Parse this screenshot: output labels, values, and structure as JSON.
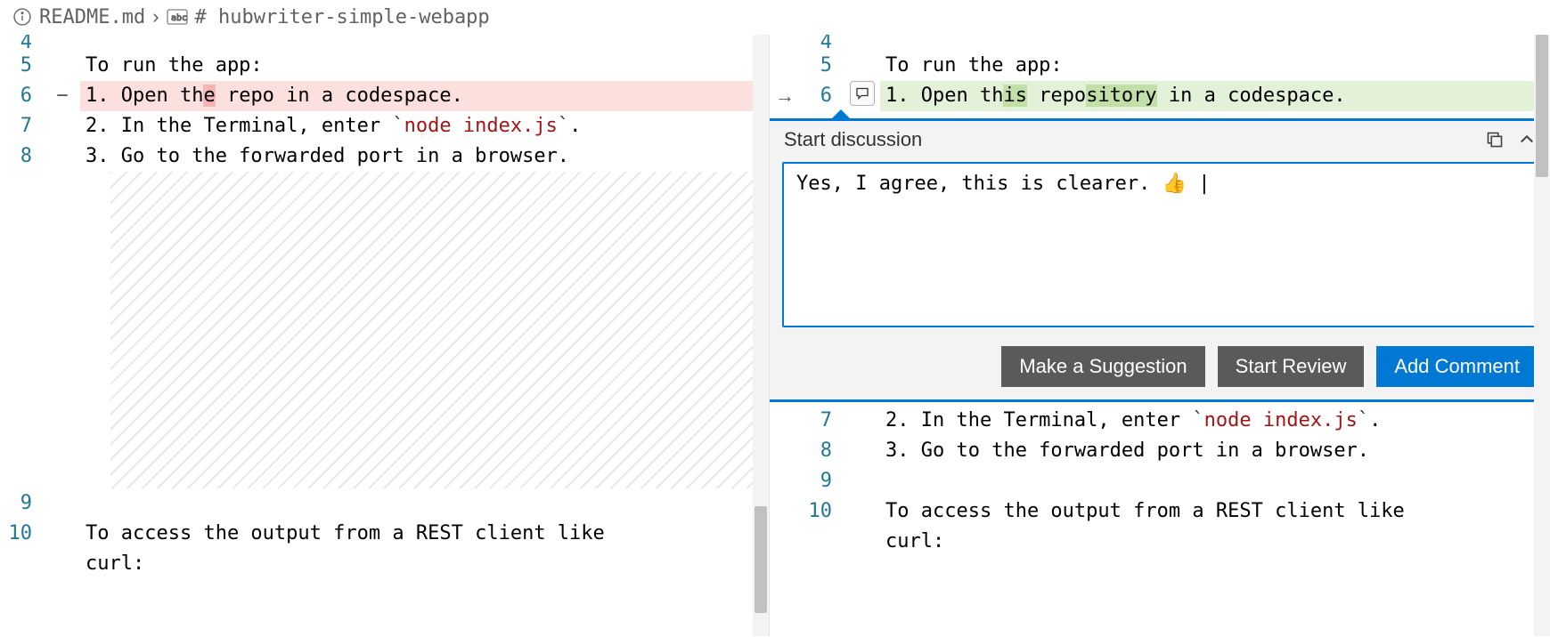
{
  "breadcrumb": {
    "file": "README.md",
    "heading": "# hubwriter-simple-webapp"
  },
  "left": {
    "lines": [
      {
        "n": "4",
        "text": ""
      },
      {
        "n": "5",
        "text": "To run the app:"
      },
      {
        "n": "6",
        "text_pre": "1. Open th",
        "text_hl": "e",
        "text_mid": " repo",
        "text_post": " in a codespace.",
        "deleted": true
      },
      {
        "n": "7",
        "text_a": "2. In the Terminal, enter ",
        "tick1": "`",
        "code": "node index.js",
        "tick2": "`",
        "text_b": "."
      },
      {
        "n": "8",
        "text": "3. Go to the forwarded port in a browser."
      },
      {
        "n": "9",
        "text": ""
      },
      {
        "n": "10",
        "text": "To access the output from a REST client like "
      },
      {
        "n": "",
        "text": "curl:"
      }
    ]
  },
  "right": {
    "lines_before": [
      {
        "n": "4",
        "text": ""
      },
      {
        "n": "5",
        "text": "To run the app:"
      },
      {
        "n": "6",
        "text_pre": "1. Open th",
        "text_hl1": "is",
        "text_mid": " repo",
        "text_hl2": "sitory",
        "text_post": " in a codespace.",
        "added": true
      }
    ],
    "lines_after": [
      {
        "n": "7",
        "text_a": "2. In the Terminal, enter ",
        "tick1": "`",
        "code": "node index.js",
        "tick2": "`",
        "text_b": "."
      },
      {
        "n": "8",
        "text": "3. Go to the forwarded port in a browser."
      },
      {
        "n": "9",
        "text": ""
      },
      {
        "n": "10",
        "text": "To access the output from a REST client like "
      },
      {
        "n": "",
        "text": "curl:"
      }
    ]
  },
  "discussion": {
    "title": "Start discussion",
    "comment_value": "Yes, I agree, this is clearer. 👍 ",
    "buttons": {
      "suggestion": "Make a Suggestion",
      "review": "Start Review",
      "add": "Add Comment"
    }
  }
}
